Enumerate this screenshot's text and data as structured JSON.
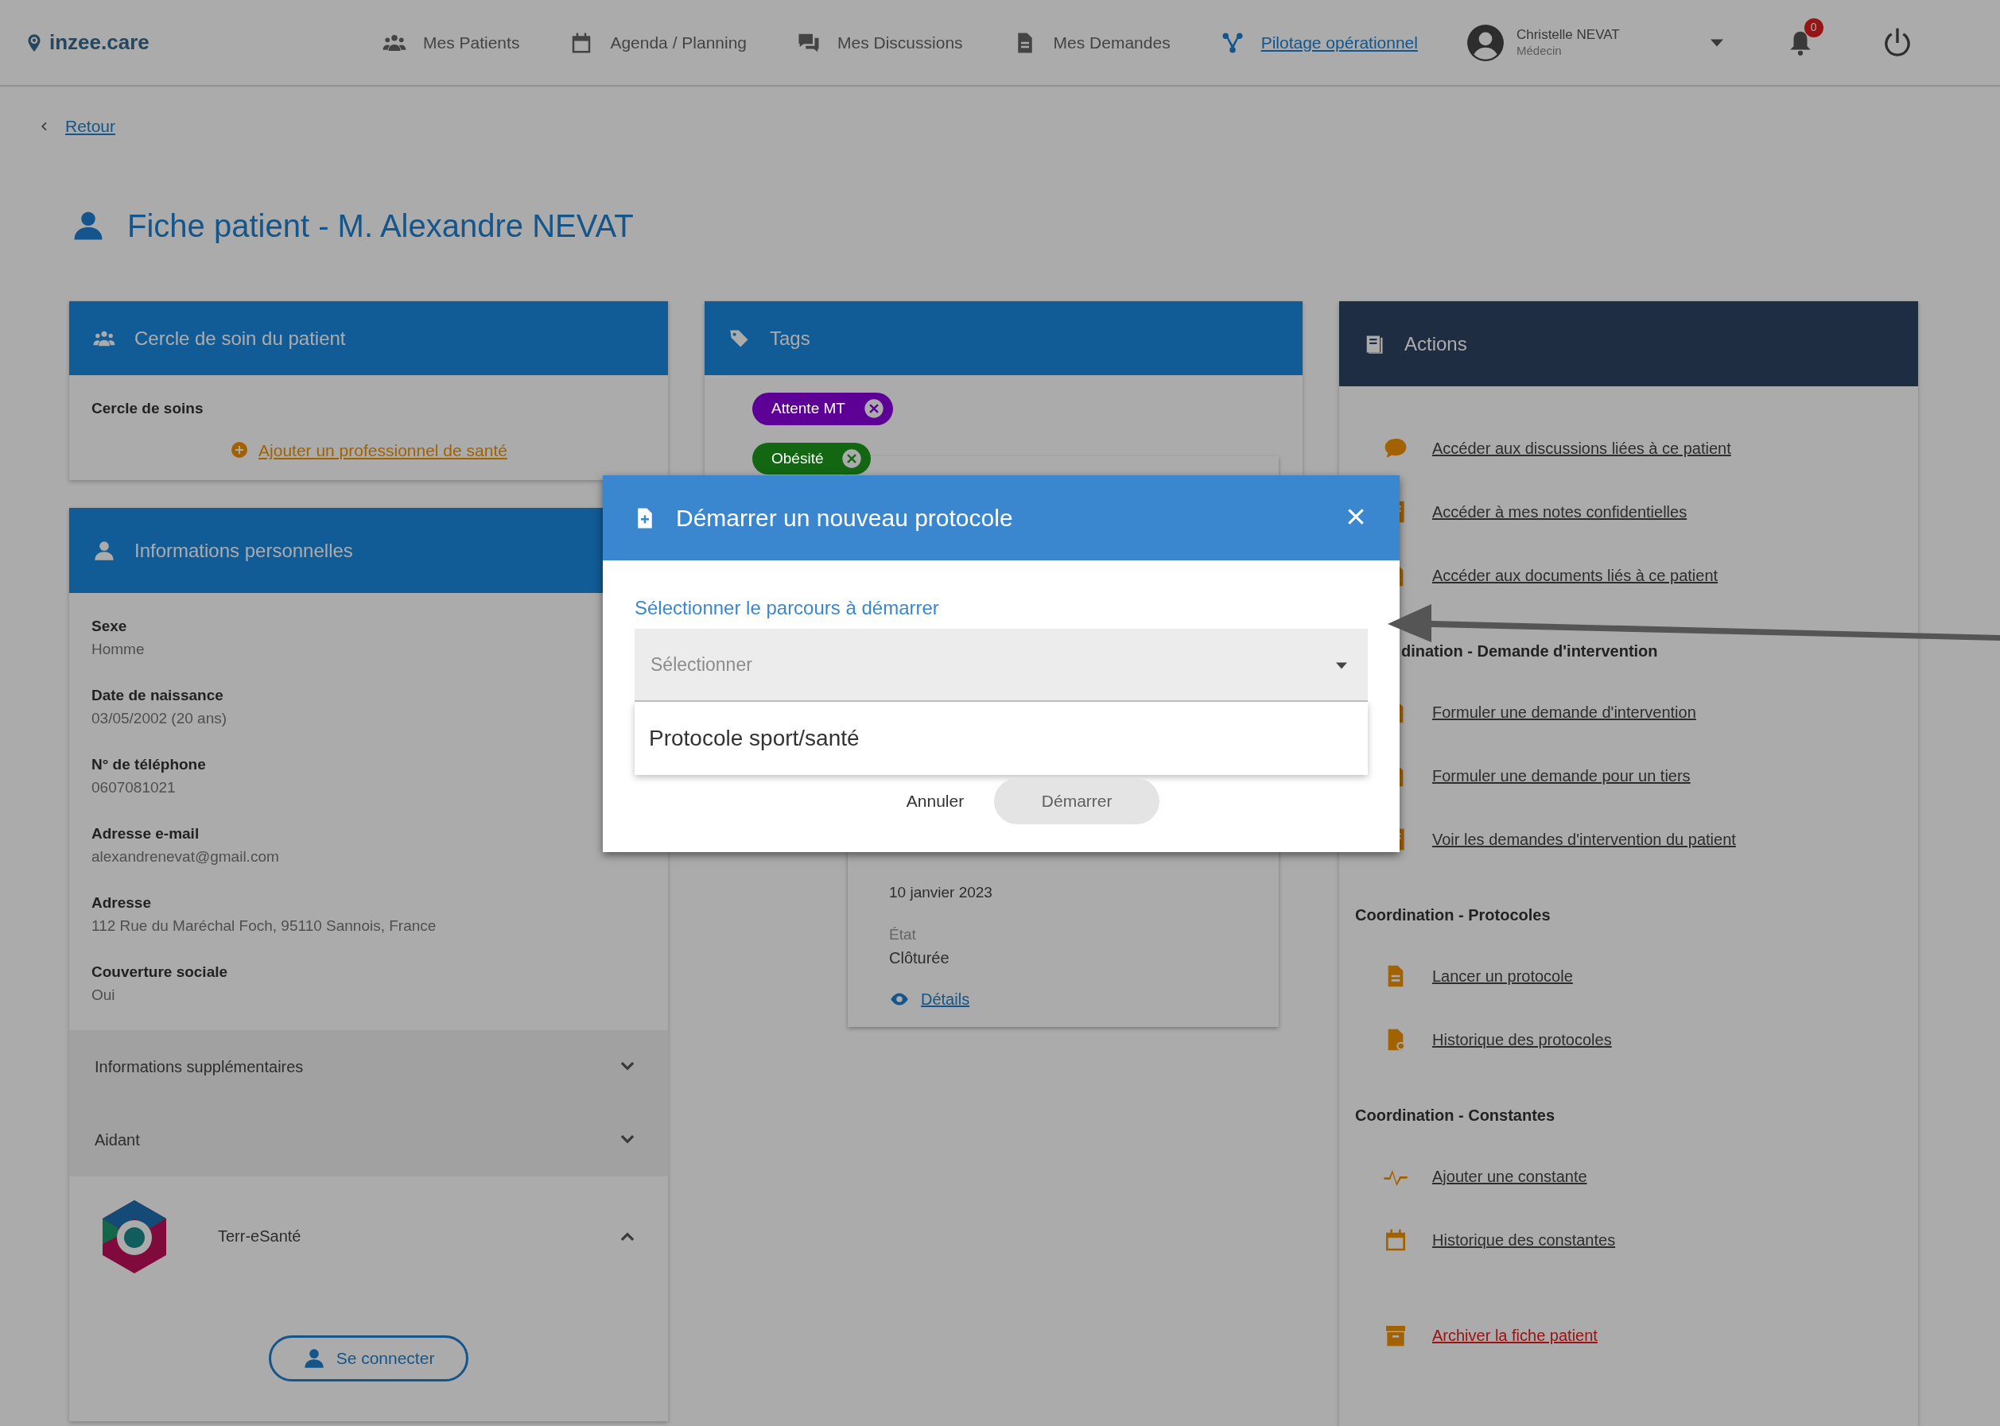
{
  "navbar": {
    "logo": "inzee.care",
    "items": [
      {
        "label": "Mes Patients",
        "selected": false
      },
      {
        "label": "Agenda / Planning",
        "selected": false
      },
      {
        "label": "Mes Discussions",
        "selected": false
      },
      {
        "label": "Mes Demandes",
        "selected": false
      },
      {
        "label": "Pilotage opérationnel",
        "selected": true
      }
    ],
    "user": {
      "name": "Christelle NEVAT",
      "role": "Médecin"
    },
    "notifications": "0"
  },
  "back_link": "Retour",
  "title": "Fiche patient - M. Alexandre NEVAT",
  "care_circle": {
    "header": "Cercle de soin du patient",
    "label": "Cercle de soins",
    "add_link": "Ajouter un professionnel de santé"
  },
  "personal_info": {
    "header": "Informations personnelles",
    "fields": [
      {
        "label": "Sexe",
        "value": "Homme"
      },
      {
        "label": "Date de naissance",
        "value": "03/05/2002 (20 ans)"
      },
      {
        "label": "N° de téléphone",
        "value": "0607081021"
      },
      {
        "label": "Adresse e-mail",
        "value": "alexandrenevat@gmail.com"
      },
      {
        "label": "Adresse",
        "value": "112 Rue du Maréchal Foch, 95110 Sannois, France"
      },
      {
        "label": "Couverture sociale",
        "value": "Oui"
      }
    ]
  },
  "accordions": [
    {
      "label": "Informations supplémentaires",
      "expanded": false
    },
    {
      "label": "Aidant",
      "expanded": false
    },
    {
      "label": "Terr-eSanté",
      "expanded": true,
      "button": "Se connecter"
    }
  ],
  "tags": {
    "header": "Tags",
    "items": [
      {
        "label": "Attente MT",
        "color": "#5c0096"
      },
      {
        "label": "Obésité",
        "color": "#136713"
      }
    ],
    "protocol_card": {
      "date": "10 janvier 2023",
      "state_label": "État",
      "state": "Clôturée",
      "details_link": "Détails"
    }
  },
  "actions": {
    "header": "Actions",
    "groups": [
      {
        "items": [
          {
            "label": "Accéder aux discussions liées à ce patient",
            "danger": false
          },
          {
            "label": "Accéder à mes notes confidentielles",
            "danger": false
          },
          {
            "label": "Accéder aux documents liés à ce patient",
            "danger": false
          }
        ]
      },
      {
        "title": "dination - Demande d'intervention",
        "items": [
          {
            "label": "Formuler une demande d'intervention",
            "danger": false
          },
          {
            "label": "Formuler une demande pour un tiers",
            "danger": false
          },
          {
            "label": "Voir les demandes d'intervention du patient",
            "danger": false
          }
        ]
      },
      {
        "title": "Coordination - Protocoles",
        "items": [
          {
            "label": "Lancer un protocole",
            "danger": false
          },
          {
            "label": "Historique des protocoles",
            "danger": false
          }
        ]
      },
      {
        "title": "Coordination - Constantes",
        "items": [
          {
            "label": "Ajouter une constante",
            "danger": false
          },
          {
            "label": "Historique des constantes",
            "danger": false
          }
        ]
      },
      {
        "items": [
          {
            "label": "Archiver la fiche patient",
            "danger": true
          }
        ]
      }
    ]
  },
  "modal": {
    "title": "Démarrer un nouveau protocole",
    "label": "Sélectionner le parcours à démarrer",
    "select": {
      "placeholder": "Sélectionner",
      "expanded": true,
      "options": [
        "Protocole sport/santé"
      ]
    },
    "buttons": [
      {
        "label": "Annuler",
        "kind": "text",
        "disabled": false
      },
      {
        "label": "Démarrer",
        "kind": "pill",
        "disabled": true
      }
    ]
  }
}
